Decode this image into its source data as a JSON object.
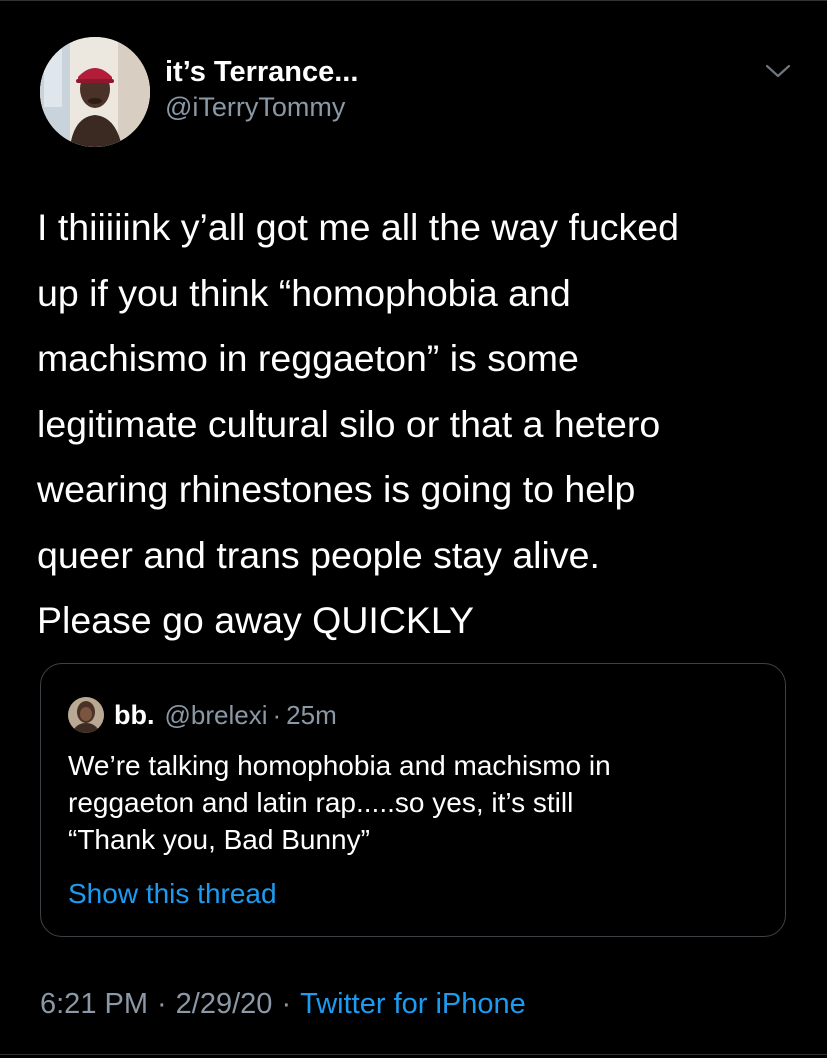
{
  "tweet": {
    "author": {
      "display_name": "it’s Terrance...",
      "handle": "@iTerryTommy",
      "avatar_icon": "profile-photo"
    },
    "menu_icon": "chevron-down-icon",
    "text": "I thiiiiink y’all got me all the way fucked\nup if you think “homophobia and\nmachismo in reggaeton” is some\nlegitimate cultural silo or that a hetero\nwearing rhinestones is going to help\nqueer and trans people stay alive.\nPlease go away QUICKLY",
    "quoted": {
      "display_name": "bb.",
      "handle": "@brelexi",
      "separator": "·",
      "time": "25m",
      "text": "We’re talking homophobia and machismo in\nreggaeton and latin rap.....so yes, it’s still\n“Thank you, Bad Bunny”",
      "show_thread_label": "Show this thread"
    },
    "meta": {
      "time": "6:21 PM",
      "separator": "·",
      "date": "2/29/20",
      "source": "Twitter for iPhone"
    }
  },
  "colors": {
    "background": "#000000",
    "text": "#ffffff",
    "secondary_text": "#8b98a5",
    "link": "#1d9bf0",
    "border": "#3d4246"
  }
}
